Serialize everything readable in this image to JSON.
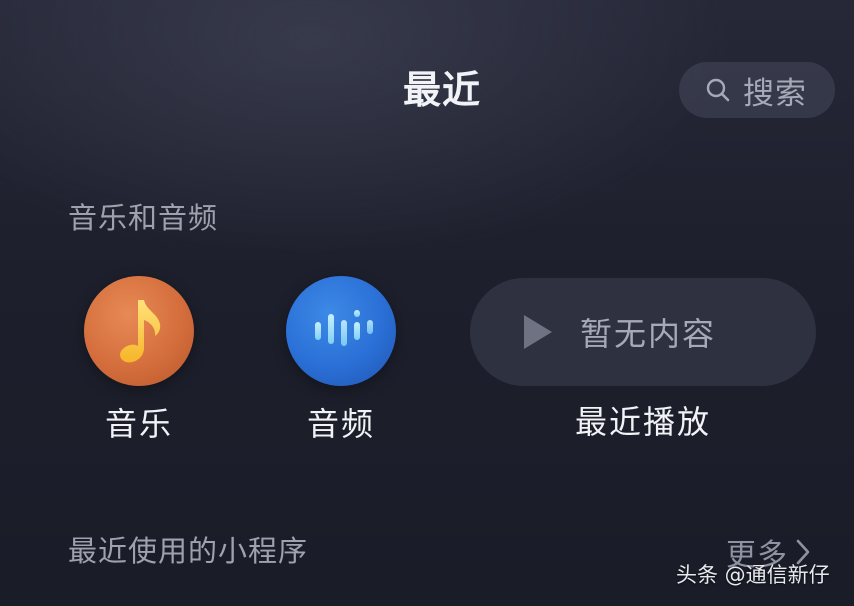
{
  "header": {
    "title": "最近",
    "search_label": "搜索"
  },
  "music_section": {
    "title": "音乐和音频",
    "apps": [
      {
        "label": "音乐",
        "icon": "music-note-icon"
      },
      {
        "label": "音频",
        "icon": "audio-wave-icon"
      }
    ],
    "recent": {
      "empty_text": "暂无内容",
      "label": "最近播放"
    }
  },
  "mini_programs": {
    "title": "最近使用的小程序",
    "more_label": "更多"
  },
  "watermark": "头条 @通信新仔",
  "colors": {
    "music_icon": "#d46e3c",
    "audio_icon": "#2a6fd6",
    "background": "#1d1f2c"
  }
}
